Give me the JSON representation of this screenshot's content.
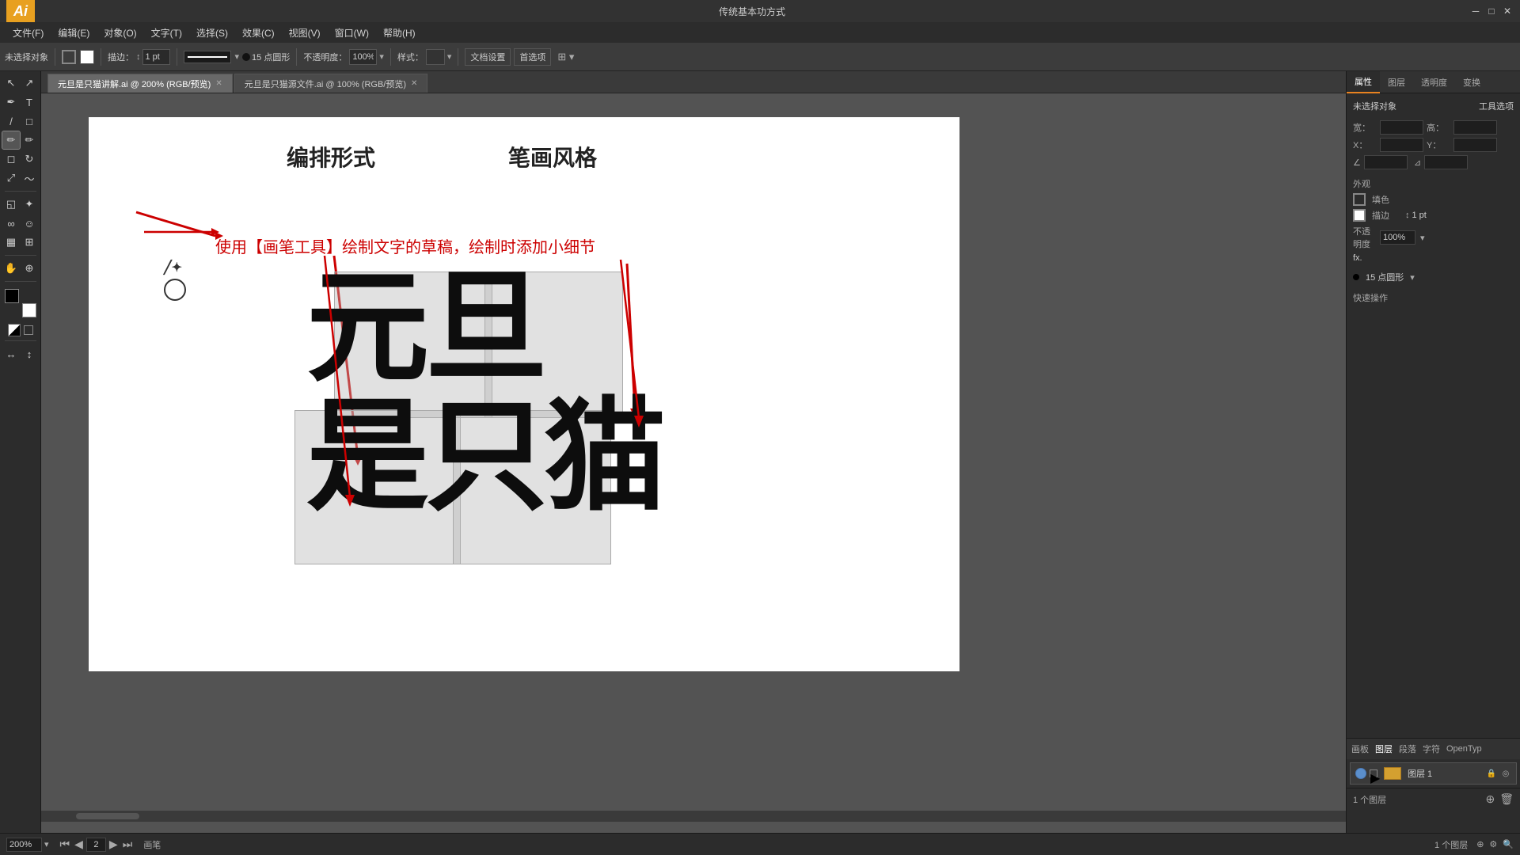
{
  "app": {
    "title": "传统基本功方式",
    "icon_label": "Ai"
  },
  "titlebar": {
    "left_label": "传统基本功方式",
    "window_controls": [
      "minimize",
      "maximize",
      "close"
    ],
    "min_symbol": "─",
    "max_symbol": "□",
    "close_symbol": "✕"
  },
  "menubar": {
    "items": [
      "文件(F)",
      "编辑(E)",
      "对象(O)",
      "文字(T)",
      "选择(S)",
      "效果(C)",
      "视图(V)",
      "窗口(W)",
      "帮助(H)"
    ]
  },
  "toolbar": {
    "tool_label": "未选择对象",
    "stroke_size_label": "描边：",
    "stroke_size_value": "1 pt",
    "point_size_label": "15 点圆形",
    "opacity_label": "不透明度：",
    "opacity_value": "100%",
    "style_label": "样式：",
    "doc_settings": "文档设置",
    "first_option": "首选项"
  },
  "tabs": [
    {
      "label": "元旦是只猫讲解.ai @ 200% (RGB/预览)",
      "active": true
    },
    {
      "label": "元旦是只猫源文件.ai @ 100% (RGB/预览)",
      "active": false
    }
  ],
  "canvas": {
    "heading_left": "编排形式",
    "heading_right": "笔画风格",
    "annotation": "使用【画笔工具】绘制文字的草稿，绘制时添加小细节",
    "calligraphy_line1": "元旦",
    "calligraphy_line2": "是只猫"
  },
  "right_panel": {
    "tabs": [
      "属性",
      "图层",
      "透明度",
      "变换"
    ],
    "active_tab": "属性",
    "no_selection": "未选择对象",
    "tool_label": "工具选项",
    "section_appearance": "外观",
    "fill_label": "填色",
    "stroke_label": "描边",
    "stroke_value": "1 pt",
    "opacity_label": "不透明度",
    "opacity_value": "100%",
    "fx_label": "fx.",
    "brush_label": "画笔",
    "brush_value": "15 点圆形",
    "quick_actions": "快速操作"
  },
  "layers_panel": {
    "tabs": [
      "画板",
      "图层",
      "段落",
      "字符",
      "OpenTyp"
    ],
    "active_tab": "图层",
    "layer_name": "图层 1",
    "layer_visible": true,
    "layer_count": "1 个图层"
  },
  "statusbar": {
    "zoom": "200%",
    "page_label": "画笔",
    "page_current": "2",
    "nav_arrows": [
      "◀◀",
      "◀",
      "▶",
      "▶▶"
    ]
  },
  "toolbox": {
    "tools": [
      {
        "name": "select-tool",
        "symbol": "↖",
        "active": false
      },
      {
        "name": "direct-select-tool",
        "symbol": "↗",
        "active": false
      },
      {
        "name": "pen-tool",
        "symbol": "✒",
        "active": false
      },
      {
        "name": "type-tool",
        "symbol": "T",
        "active": false
      },
      {
        "name": "line-tool",
        "symbol": "\\",
        "active": false
      },
      {
        "name": "rectangle-tool",
        "symbol": "□",
        "active": false
      },
      {
        "name": "paintbrush-tool",
        "symbol": "⌇",
        "active": true
      },
      {
        "name": "pencil-tool",
        "symbol": "✏",
        "active": false
      },
      {
        "name": "eraser-tool",
        "symbol": "◻",
        "active": false
      },
      {
        "name": "rotate-tool",
        "symbol": "↻",
        "active": false
      },
      {
        "name": "scale-tool",
        "symbol": "⤢",
        "active": false
      },
      {
        "name": "warp-tool",
        "symbol": "〜",
        "active": false
      },
      {
        "name": "gradient-tool",
        "symbol": "◱",
        "active": false
      },
      {
        "name": "eyedropper-tool",
        "symbol": "⚗",
        "active": false
      },
      {
        "name": "blend-tool",
        "symbol": "8",
        "active": false
      },
      {
        "name": "column-graph-tool",
        "symbol": "▦",
        "active": false
      },
      {
        "name": "artboard-tool",
        "symbol": "⊞",
        "active": false
      },
      {
        "name": "hand-tool",
        "symbol": "✋",
        "active": false
      },
      {
        "name": "zoom-tool",
        "symbol": "🔍",
        "active": false
      }
    ]
  }
}
